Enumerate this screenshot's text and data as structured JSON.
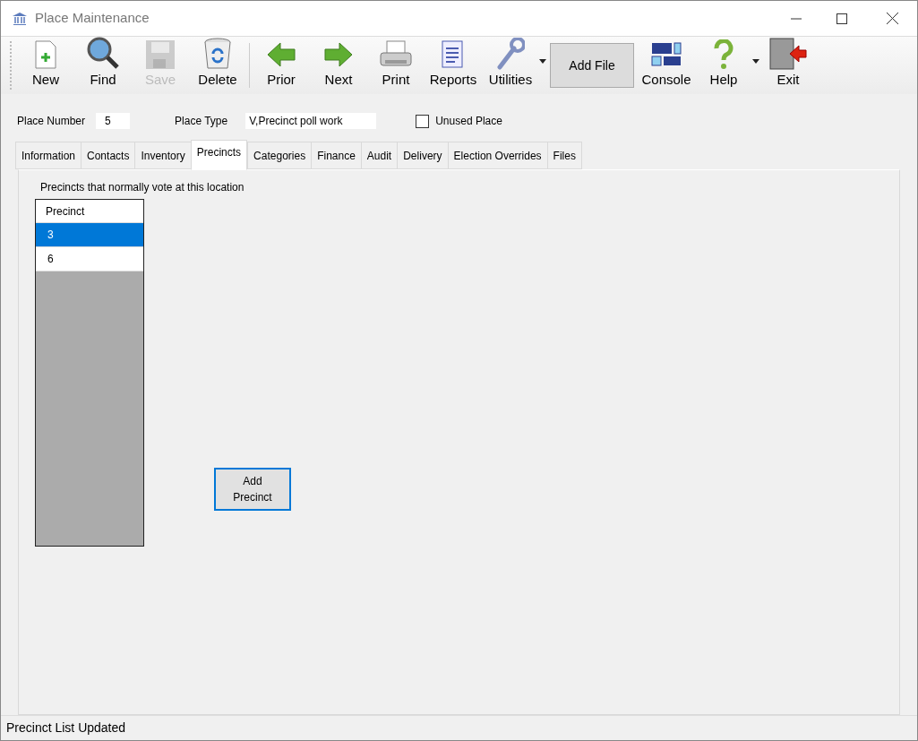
{
  "window": {
    "title": "Place Maintenance"
  },
  "toolbar": [
    {
      "label": "New",
      "kind": "button",
      "disabled": false
    },
    {
      "label": "Find",
      "kind": "button",
      "disabled": false
    },
    {
      "label": "Save",
      "kind": "button",
      "disabled": true
    },
    {
      "label": "Delete",
      "kind": "button",
      "disabled": false
    },
    {
      "kind": "separator"
    },
    {
      "label": "Prior",
      "kind": "button",
      "disabled": false
    },
    {
      "label": "Next",
      "kind": "button",
      "disabled": false
    },
    {
      "label": "Print",
      "kind": "button",
      "disabled": false
    },
    {
      "label": "Reports",
      "kind": "button",
      "disabled": false
    },
    {
      "label": "Utilities",
      "kind": "dropdown",
      "disabled": false
    },
    {
      "label": "Add File",
      "kind": "text"
    },
    {
      "label": "Console",
      "kind": "button",
      "disabled": false
    },
    {
      "label": "Help",
      "kind": "dropdown",
      "disabled": false
    },
    {
      "label": "Exit",
      "kind": "button",
      "disabled": false
    }
  ],
  "fields": {
    "place_number": {
      "label": "Place Number",
      "value": "5"
    },
    "place_type": {
      "label": "Place Type",
      "value": "V,Precinct poll work"
    },
    "unused_place": {
      "label": "Unused Place",
      "checked": false
    }
  },
  "tabs": [
    {
      "label": "Information",
      "selected": false
    },
    {
      "label": "Contacts",
      "selected": false
    },
    {
      "label": "Inventory",
      "selected": false
    },
    {
      "label": "Precincts",
      "selected": true
    },
    {
      "label": "Categories",
      "selected": false
    },
    {
      "label": "Finance",
      "selected": false
    },
    {
      "label": "Audit",
      "selected": false
    },
    {
      "label": "Delivery",
      "selected": false
    },
    {
      "label": "Election Overrides",
      "selected": false
    },
    {
      "label": "Files",
      "selected": false
    }
  ],
  "precincts": {
    "caption": "Precincts that normally vote at this location",
    "column": "Precinct",
    "rows": [
      {
        "value": "3",
        "selected": true
      },
      {
        "value": "6",
        "selected": false
      }
    ]
  },
  "add_button": "Add Precinct",
  "status_bar": "Precinct List Updated"
}
